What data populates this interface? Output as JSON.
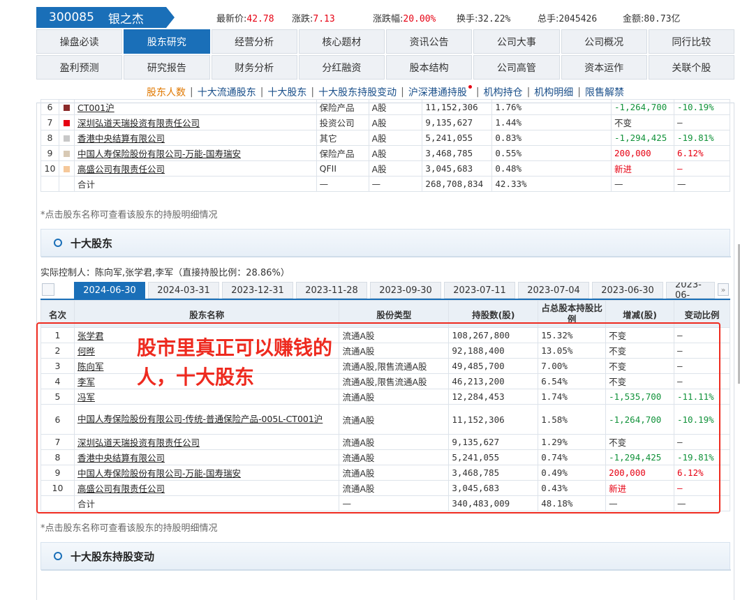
{
  "stock": {
    "code": "300085",
    "name": "银之杰"
  },
  "quote": [
    {
      "label": "最新价:",
      "value": "42.78",
      "color": "#e60012"
    },
    {
      "label": "涨跌:",
      "value": "7.13",
      "color": "#e60012"
    },
    {
      "label": "涨跌幅:",
      "value": "20.00%",
      "color": "#e60012"
    },
    {
      "label": "换手:",
      "value": "32.22%",
      "color": "#333333"
    },
    {
      "label": "总手:",
      "value": "2045426",
      "color": "#333333"
    },
    {
      "label": "金额:",
      "value": "80.73亿",
      "color": "#333333"
    }
  ],
  "nav_row1": [
    "操盘必读",
    "股东研究",
    "经营分析",
    "核心题材",
    "资讯公告",
    "公司大事",
    "公司概况",
    "同行比较"
  ],
  "nav_row2": [
    "盈利预测",
    "研究报告",
    "财务分析",
    "分红融资",
    "股本结构",
    "公司高管",
    "资本运作",
    "关联个股"
  ],
  "nav_active": "股东研究",
  "subnav": [
    "股东人数",
    "十大流通股东",
    "十大股东",
    "十大股东持股变动",
    "沪深港通持股",
    "机构持仓",
    "机构明细",
    "限售解禁"
  ],
  "float_holders_partial": {
    "rows": [
      {
        "rank": "6",
        "color": "#8b2a2a",
        "name": "CT001沪",
        "type": "保险产品",
        "share": "A股",
        "count": "11,152,306",
        "ratio": "1.76%",
        "change": "-1,264,700",
        "change_color": "green",
        "pct": "-10.19%",
        "pct_color": "green"
      },
      {
        "rank": "7",
        "color": "#e60012",
        "name": "深圳弘道天瑞投资有限责任公司",
        "type": "投资公司",
        "share": "A股",
        "count": "9,135,627",
        "ratio": "1.44%",
        "change": "不变",
        "change_color": "",
        "pct": "—",
        "pct_color": ""
      },
      {
        "rank": "8",
        "color": "#c8c8c8",
        "name": "香港中央结算有限公司",
        "type": "其它",
        "share": "A股",
        "count": "5,241,055",
        "ratio": "0.83%",
        "change": "-1,294,425",
        "change_color": "green",
        "pct": "-19.81%",
        "pct_color": "green"
      },
      {
        "rank": "9",
        "color": "#d8c9b4",
        "name": "中国人寿保险股份有限公司-万能-国寿瑞安",
        "type": "保险产品",
        "share": "A股",
        "count": "3,468,785",
        "ratio": "0.55%",
        "change": "200,000",
        "change_color": "red",
        "pct": "6.12%",
        "pct_color": "red"
      },
      {
        "rank": "10",
        "color": "#f5c89a",
        "name": "高盛公司有限责任公司",
        "type": "QFII",
        "share": "A股",
        "count": "3,045,683",
        "ratio": "0.48%",
        "change": "新进",
        "change_color": "red",
        "pct": "—",
        "pct_color": "red"
      }
    ],
    "total": {
      "label": "合计",
      "type": "—",
      "share": "—",
      "count": "268,708,834",
      "ratio": "42.33%",
      "change": "—",
      "pct": "—"
    }
  },
  "note": "*点击股东名称可查看该股东的持股明细情况",
  "section_top10": "十大股东",
  "controller": "实际控制人：陈向军,张学君,李军（直接持股比例：28.86%）",
  "date_tabs": [
    "2024-06-30",
    "2024-03-31",
    "2023-12-31",
    "2023-11-28",
    "2023-09-30",
    "2023-07-11",
    "2023-07-04",
    "2023-06-30",
    "2023-06-"
  ],
  "top10": {
    "headers": [
      "名次",
      "股东名称",
      "股份类型",
      "持股数(股)",
      "占总股本持股比例",
      "增减(股)",
      "变动比例"
    ],
    "rows": [
      {
        "rank": "1",
        "name": "张学君",
        "type": "流通A股",
        "count": "108,267,800",
        "ratio": "15.32%",
        "change": "不变",
        "change_color": "",
        "pct": "—",
        "pct_color": ""
      },
      {
        "rank": "2",
        "name": "何晔",
        "type": "流通A股",
        "count": "92,188,400",
        "ratio": "13.05%",
        "change": "不变",
        "change_color": "",
        "pct": "—",
        "pct_color": ""
      },
      {
        "rank": "3",
        "name": "陈向军",
        "type": "流通A股,限售流通A股",
        "count": "49,485,700",
        "ratio": "7.00%",
        "change": "不变",
        "change_color": "",
        "pct": "—",
        "pct_color": ""
      },
      {
        "rank": "4",
        "name": "李军",
        "type": "流通A股,限售流通A股",
        "count": "46,213,200",
        "ratio": "6.54%",
        "change": "不变",
        "change_color": "",
        "pct": "—",
        "pct_color": ""
      },
      {
        "rank": "5",
        "name": "冯军",
        "type": "流通A股",
        "count": "12,284,453",
        "ratio": "1.74%",
        "change": "-1,535,700",
        "change_color": "green",
        "pct": "-11.11%",
        "pct_color": "green"
      },
      {
        "rank": "6",
        "name": "中国人寿保险股份有限公司-传统-普通保险产品-005L-CT001沪",
        "type": "流通A股",
        "count": "11,152,306",
        "ratio": "1.58%",
        "change": "-1,264,700",
        "change_color": "green",
        "pct": "-10.19%",
        "pct_color": "green"
      },
      {
        "rank": "7",
        "name": "深圳弘道天瑞投资有限责任公司",
        "type": "流通A股",
        "count": "9,135,627",
        "ratio": "1.29%",
        "change": "不变",
        "change_color": "",
        "pct": "—",
        "pct_color": ""
      },
      {
        "rank": "8",
        "name": "香港中央结算有限公司",
        "type": "流通A股",
        "count": "5,241,055",
        "ratio": "0.74%",
        "change": "-1,294,425",
        "change_color": "green",
        "pct": "-19.81%",
        "pct_color": "green"
      },
      {
        "rank": "9",
        "name": "中国人寿保险股份有限公司-万能-国寿瑞安",
        "type": "流通A股",
        "count": "3,468,785",
        "ratio": "0.49%",
        "change": "200,000",
        "change_color": "red",
        "pct": "6.12%",
        "pct_color": "red"
      },
      {
        "rank": "10",
        "name": "高盛公司有限责任公司",
        "type": "流通A股",
        "count": "3,045,683",
        "ratio": "0.43%",
        "change": "新进",
        "change_color": "red",
        "pct": "—",
        "pct_color": "red"
      }
    ],
    "total": {
      "label": "合计",
      "type": "—",
      "count": "340,483,009",
      "ratio": "48.18%",
      "change": "—",
      "pct": "—"
    }
  },
  "annotation": "股市里真正可以赚钱的人，十大股东",
  "section_changes": "十大股东持股变动"
}
